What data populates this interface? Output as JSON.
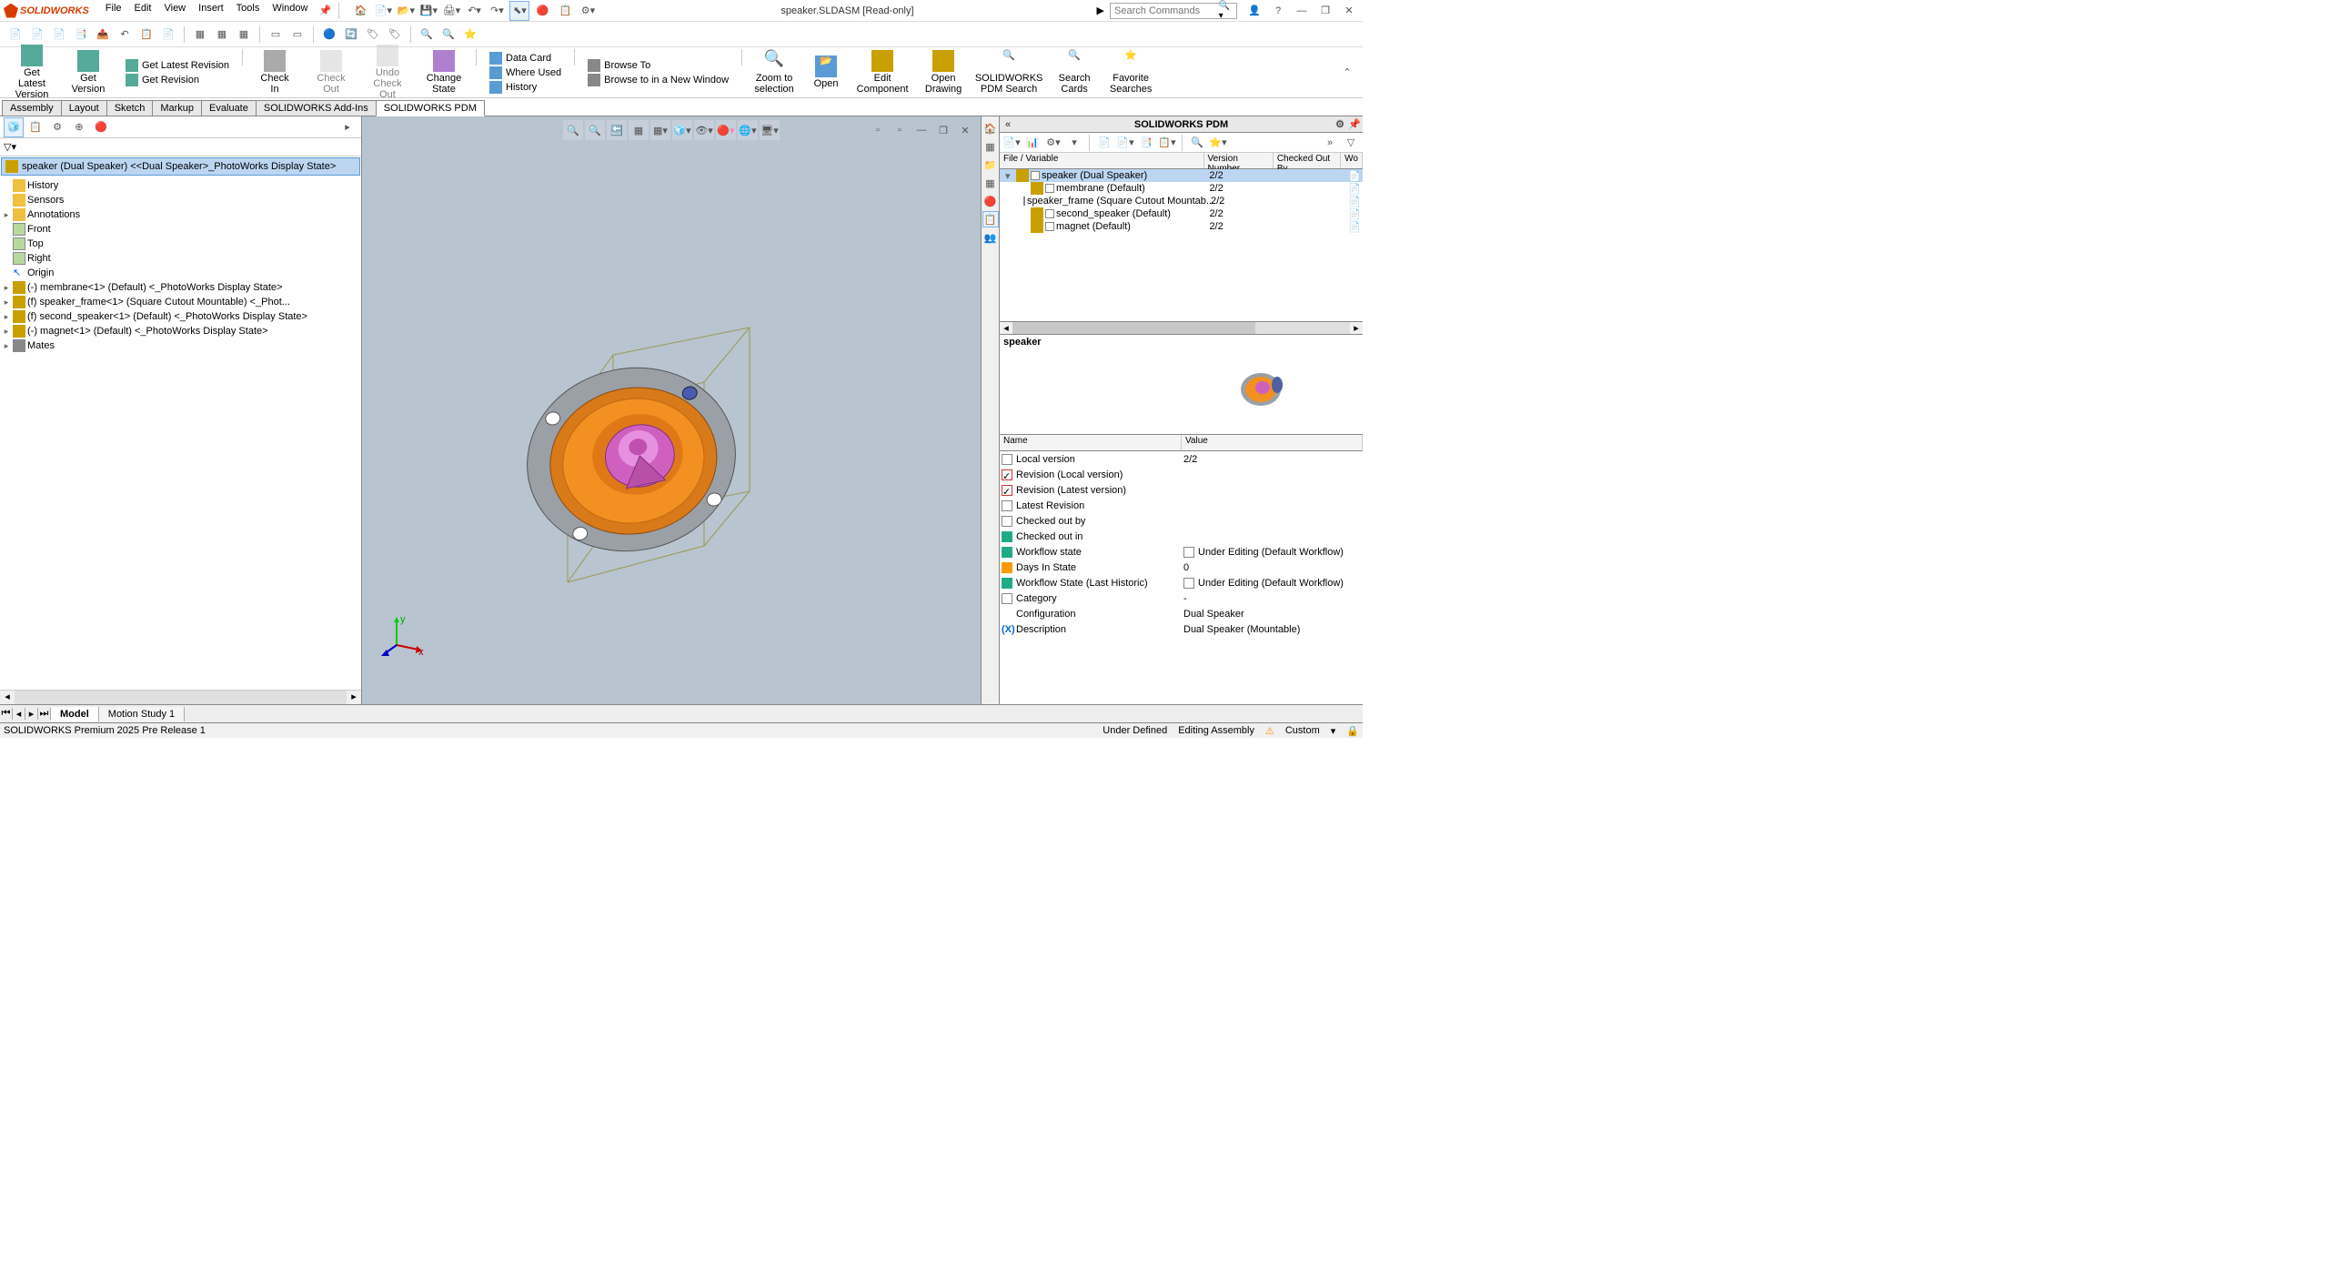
{
  "app": {
    "name": "SOLIDWORKS"
  },
  "menu": [
    "File",
    "Edit",
    "View",
    "Insert",
    "Tools",
    "Window"
  ],
  "doc_title": "speaker.SLDASM [Read-only]",
  "search": {
    "placeholder": "Search Commands"
  },
  "ribbon": {
    "btns_lg": [
      {
        "l1": "Get",
        "l2": "Latest",
        "l3": "Version"
      },
      {
        "l1": "Get",
        "l2": "Version",
        "l3": ""
      },
      {
        "l1": "Check",
        "l2": "In",
        "l3": ""
      },
      {
        "l1": "Check",
        "l2": "Out",
        "l3": ""
      },
      {
        "l1": "Undo",
        "l2": "Check",
        "l3": "Out"
      },
      {
        "l1": "Change",
        "l2": "State",
        "l3": ""
      },
      {
        "l1": "Zoom to",
        "l2": "selection",
        "l3": ""
      },
      {
        "l1": "Open",
        "l2": "",
        "l3": ""
      },
      {
        "l1": "Edit",
        "l2": "Component",
        "l3": ""
      },
      {
        "l1": "Open",
        "l2": "Drawing",
        "l3": ""
      },
      {
        "l1": "SOLIDWORKS",
        "l2": "PDM Search",
        "l3": ""
      },
      {
        "l1": "Search",
        "l2": "Cards",
        "l3": ""
      },
      {
        "l1": "Favorite",
        "l2": "Searches",
        "l3": ""
      }
    ],
    "sm1": [
      "Get Latest Revision",
      "Get Revision"
    ],
    "sm2": [
      "Data Card",
      "Where Used",
      "History"
    ],
    "sm3": [
      "Browse To",
      "Browse to in a New Window"
    ]
  },
  "tabs": [
    "Assembly",
    "Layout",
    "Sketch",
    "Markup",
    "Evaluate",
    "SOLIDWORKS Add-Ins",
    "SOLIDWORKS PDM"
  ],
  "active_tab": "SOLIDWORKS PDM",
  "tree": {
    "root": "speaker (Dual Speaker) <<Dual Speaker>_PhotoWorks Display State>",
    "items": [
      {
        "t": "History",
        "ic": "folder",
        "exp": ""
      },
      {
        "t": "Sensors",
        "ic": "folder",
        "exp": ""
      },
      {
        "t": "Annotations",
        "ic": "folder",
        "exp": "▸"
      },
      {
        "t": "Front",
        "ic": "plane",
        "exp": ""
      },
      {
        "t": "Top",
        "ic": "plane",
        "exp": ""
      },
      {
        "t": "Right",
        "ic": "plane",
        "exp": ""
      },
      {
        "t": "Origin",
        "ic": "origin",
        "exp": ""
      },
      {
        "t": "(-) membrane<1> (Default) <<Default>_PhotoWorks Display State>",
        "ic": "part",
        "exp": "▸"
      },
      {
        "t": "(f) speaker_frame<1> (Square Cutout Mountable) <<Square Cutout Mountable>_Phot...",
        "ic": "part",
        "exp": "▸"
      },
      {
        "t": "(f) second_speaker<1> (Default) <<Default>_PhotoWorks Display State>",
        "ic": "part",
        "exp": "▸"
      },
      {
        "t": "(-) magnet<1> (Default) <<Default>_PhotoWorks Display State>",
        "ic": "part",
        "exp": "▸"
      },
      {
        "t": "Mates",
        "ic": "mates",
        "exp": "▸"
      }
    ]
  },
  "pdm": {
    "title": "SOLIDWORKS PDM",
    "cols": [
      "File / Variable",
      "Version Number",
      "Checked Out By",
      "Wo"
    ],
    "rows": [
      {
        "indent": 0,
        "name": "speaker  (Dual Speaker)",
        "ver": "2/2",
        "sel": true
      },
      {
        "indent": 1,
        "name": "membrane  (Default)",
        "ver": "2/2"
      },
      {
        "indent": 1,
        "name": "speaker_frame  (Square Cutout Mountab...",
        "ver": "2/2"
      },
      {
        "indent": 1,
        "name": "second_speaker  (Default)",
        "ver": "2/2"
      },
      {
        "indent": 1,
        "name": "magnet  (Default)",
        "ver": "2/2"
      }
    ],
    "preview_title": "speaker",
    "prop_cols": [
      "Name",
      "Value"
    ],
    "props": [
      {
        "n": "Local version",
        "v": "2/2",
        "ic": "doc"
      },
      {
        "n": "Revision (Local version)",
        "v": "",
        "ic": "check"
      },
      {
        "n": "Revision (Latest version)",
        "v": "",
        "ic": "check"
      },
      {
        "n": "Latest Revision",
        "v": "",
        "ic": "doc"
      },
      {
        "n": "Checked out by",
        "v": "",
        "ic": "doc"
      },
      {
        "n": "Checked out in",
        "v": "",
        "ic": "state"
      },
      {
        "n": "Workflow state",
        "v": "Under Editing (Default Workflow)",
        "ic": "state",
        "vic": "doc"
      },
      {
        "n": "Days In State",
        "v": "0",
        "ic": "cal"
      },
      {
        "n": "Workflow State (Last Historic)",
        "v": "Under Editing (Default Workflow)",
        "ic": "state",
        "vic": "doc"
      },
      {
        "n": "Category",
        "v": "-",
        "ic": "doc"
      },
      {
        "n": "Configuration",
        "v": "Dual Speaker",
        "ic": ""
      },
      {
        "n": "Description",
        "v": "Dual Speaker (Mountable)",
        "ic": "var"
      }
    ]
  },
  "bottom_tabs": [
    "Model",
    "Motion Study 1"
  ],
  "status": {
    "left": "SOLIDWORKS Premium 2025 Pre Release 1",
    "r1": "Under Defined",
    "r2": "Editing Assembly",
    "r3": "Custom"
  }
}
